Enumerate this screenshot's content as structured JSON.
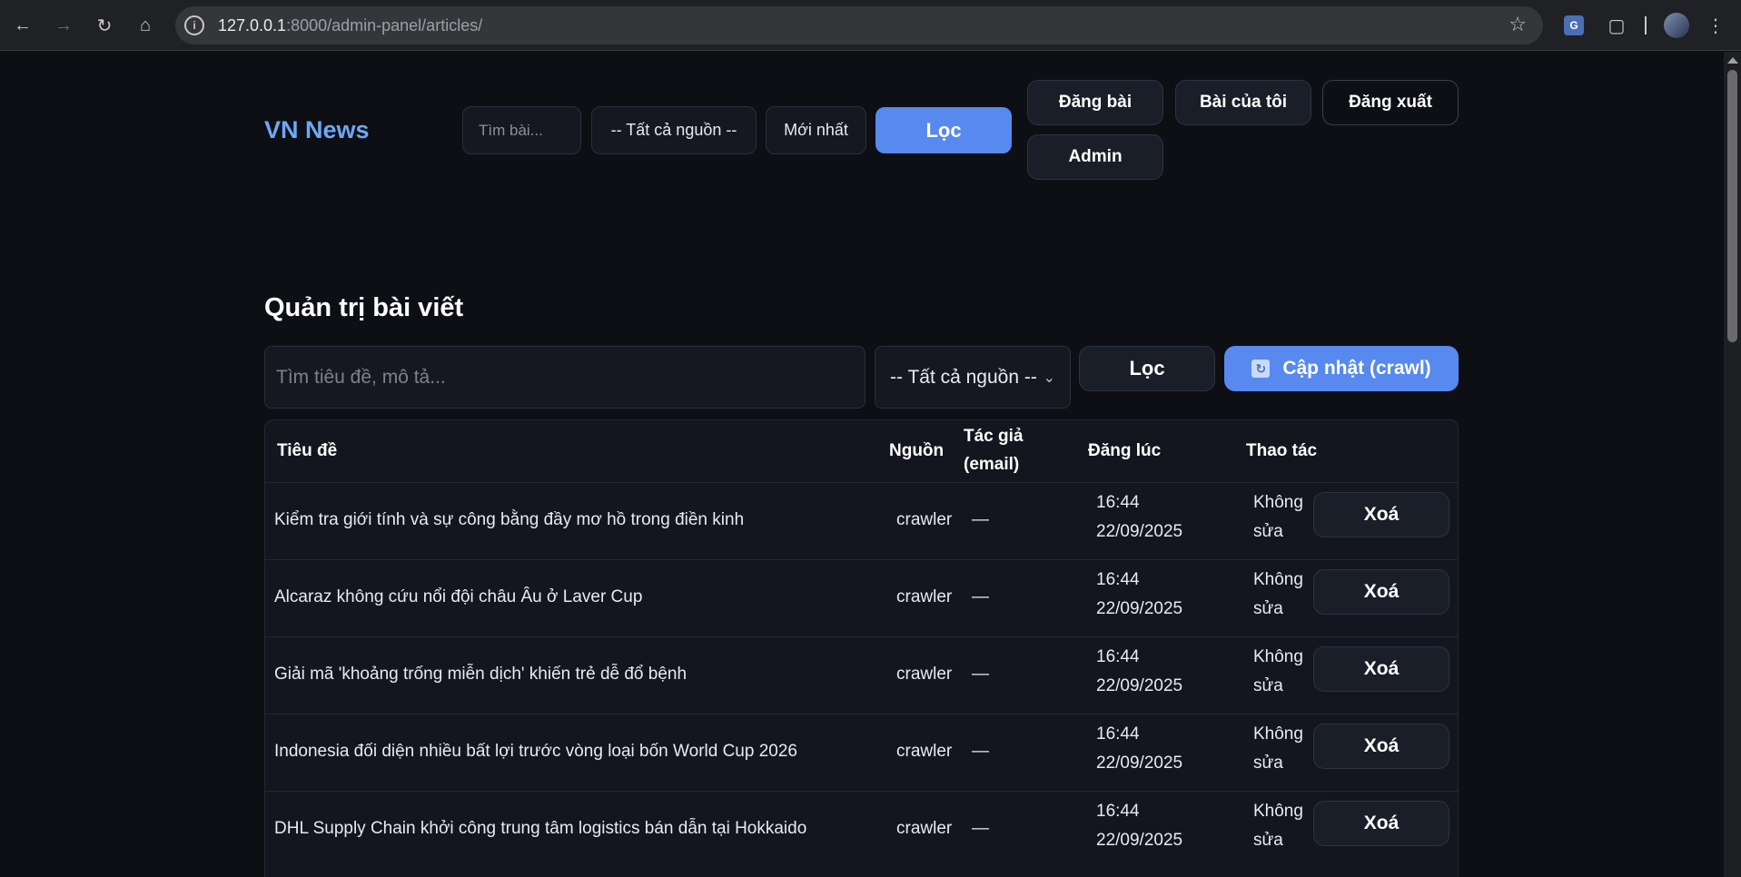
{
  "browser": {
    "url_host": "127.0.0.1",
    "url_rest": ":8000/admin-panel/articles/"
  },
  "header": {
    "brand": "VN News",
    "search_placeholder": "Tìm bài...",
    "source_select": "-- Tất cả nguồn --",
    "sort_select": "Mới nhất",
    "filter_label": "Lọc",
    "nav": {
      "post": "Đăng bài",
      "my_posts": "Bài của tôi",
      "logout": "Đăng xuất",
      "admin": "Admin"
    }
  },
  "admin": {
    "title": "Quản trị bài viết",
    "search_placeholder": "Tìm tiêu đề, mô tả...",
    "source_select": "-- Tất cả nguồn --",
    "filter_label": "Lọc",
    "crawl_label": "Cập nhật (crawl)"
  },
  "table": {
    "columns": {
      "title": "Tiêu đề",
      "source": "Nguồn",
      "author_line1": "Tác giả",
      "author_line2": "(email)",
      "published": "Đăng lúc",
      "actions": "Thao tác"
    },
    "rows": [
      {
        "title": "Kiểm tra giới tính và sự công bằng đầy mơ hồ trong điền kinh",
        "source": "crawler",
        "author": "—",
        "time": "16:44",
        "date": "22/09/2025",
        "edit_line1": "Không",
        "edit_line2": "sửa",
        "delete": "Xoá"
      },
      {
        "title": "Alcaraz không cứu nổi đội châu Âu ở Laver Cup",
        "source": "crawler",
        "author": "—",
        "time": "16:44",
        "date": "22/09/2025",
        "edit_line1": "Không",
        "edit_line2": "sửa",
        "delete": "Xoá"
      },
      {
        "title": "Giải mã 'khoảng trống miễn dịch' khiến trẻ dễ đổ bệnh",
        "source": "crawler",
        "author": "—",
        "time": "16:44",
        "date": "22/09/2025",
        "edit_line1": "Không",
        "edit_line2": "sửa",
        "delete": "Xoá"
      },
      {
        "title": "Indonesia đối diện nhiều bất lợi trước vòng loại bốn World Cup 2026",
        "source": "crawler",
        "author": "—",
        "time": "16:44",
        "date": "22/09/2025",
        "edit_line1": "Không",
        "edit_line2": "sửa",
        "delete": "Xoá"
      },
      {
        "title": "DHL Supply Chain khởi công trung tâm logistics bán dẫn tại Hokkaido",
        "source": "crawler",
        "author": "—",
        "time": "16:44",
        "date": "22/09/2025",
        "edit_line1": "Không",
        "edit_line2": "sửa",
        "delete": "Xoá"
      }
    ]
  },
  "colors": {
    "accent": "#5789ee",
    "brand": "#6ea8f4",
    "background": "#0d0f15"
  }
}
